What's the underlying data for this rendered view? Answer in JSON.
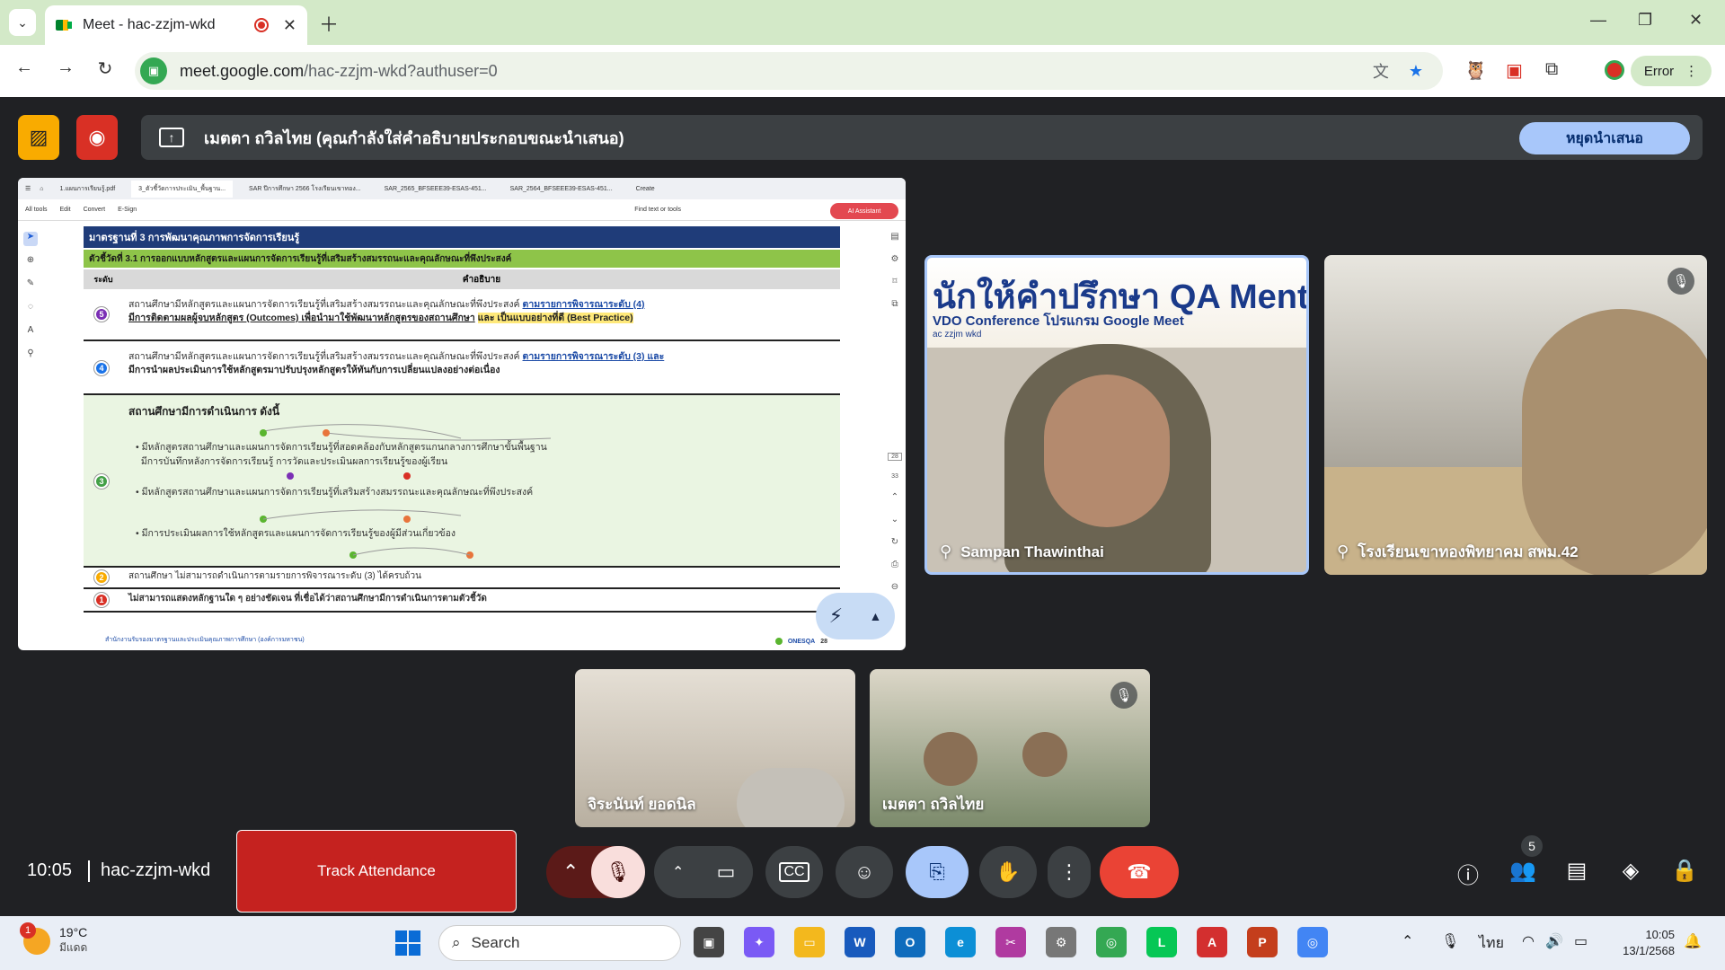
{
  "browser": {
    "tab_title": "Meet - hac-zzjm-wkd",
    "url_host": "meet.google.com",
    "url_path": "/hac-zzjm-wkd?authuser=0",
    "profile_label": "Error"
  },
  "meet": {
    "presenting_banner": "เมตตา ถวิลไทย (คุณกำลังใส่คำอธิบายประกอบขณะนำเสนอ)",
    "stop_presenting": "หยุดนำเสนอ",
    "time": "10:05",
    "meeting_code": "hac-zzjm-wkd",
    "track_attendance": "Track Attendance",
    "participant_count": "5",
    "participants": [
      {
        "name": "Sampan Thawinthai"
      },
      {
        "name": "โรงเรียนเขาทองพิทยาคม สพม.42"
      },
      {
        "name": "จิระนันท์ ยอดนิล"
      },
      {
        "name": "เมตตา ถวิลไทย"
      }
    ],
    "qa_banner": {
      "title": "นักให้คำปรึกษา QA Mentor",
      "sub": "VDO Conference โปรแกรม Google Meet",
      "code": "ac zzjm wkd"
    }
  },
  "shared_doc": {
    "tabs": [
      "1.แผนการเรียนรู้.pdf",
      "3_ตัวชี้วัดการประเมิน_พื้นฐาน...",
      "SAR ปีการศึกษา 2566 โรงเรียนเขาทอง...",
      "SAR_2565_BFSEEE39-ESAS-451...",
      "SAR_2564_BFSEEE39-ESAS-451...",
      "Create"
    ],
    "tools": [
      "All tools",
      "Edit",
      "Convert",
      "E-Sign"
    ],
    "find_label": "Find text or tools",
    "ai_label": "AI Assistant",
    "standard_title": "มาตรฐานที่ 3 การพัฒนาคุณภาพการจัดการเรียนรู้",
    "indicator": "ตัวชี้วัดที่ 3.1 การออกแบบหลักสูตรและแผนการจัดการเรียนรู้ที่เสริมสร้างสมรรถนะและคุณลักษณะที่พึงประสงค์",
    "col_level": "ระดับ",
    "col_desc": "คำอธิบาย",
    "level5_a": "สถานศึกษามีหลักสูตรและแผนการจัดการเรียนรู้ที่เสริมสร้างสมรรถนะและคุณลักษณะที่พึงประสงค์",
    "level5_b": "ตามรายการพิจารณาระดับ (4)",
    "level5_c": "มีการติดตามผลผู้จบหลักสูตร (Outcomes) เพื่อนำมาใช้พัฒนาหลักสูตรของสถานศึกษา",
    "level5_d": "และ เป็นแบบอย่างที่ดี (Best Practice)",
    "level4_a": "สถานศึกษามีหลักสูตรและแผนการจัดการเรียนรู้ที่เสริมสร้างสมรรถนะและคุณลักษณะที่พึงประสงค์",
    "level4_b": "ตามรายการพิจารณาระดับ (3) และ",
    "level4_c": "มีการนำผลประเมินการใช้หลักสูตรมาปรับปรุงหลักสูตรให้ทันกับการเปลี่ยนแปลงอย่างต่อเนื่อง",
    "level3_head": "สถานศึกษามีการดำเนินการ ดังนี้",
    "level3_b1": "มีหลักสูตรสถานศึกษาและแผนการจัดการเรียนรู้ที่สอดคล้องกับหลักสูตรแกนกลางการศึกษาขั้นพื้นฐาน",
    "level3_b1b": "มีการบันทึกหลังการจัดการเรียนรู้ การวัดและประเมินผลการเรียนรู้ของผู้เรียน",
    "level3_b2": "มีหลักสูตรสถานศึกษาและแผนการจัดการเรียนรู้ที่เสริมสร้างสมรรถนะและคุณลักษณะที่พึงประสงค์",
    "level3_b3": "มีการประเมินผลการใช้หลักสูตรและแผนการจัดการเรียนรู้ของผู้มีส่วนเกี่ยวข้อง",
    "level2": "สถานศึกษา ไม่สามารถดำเนินการตามรายการพิจารณาระดับ (3) ได้ครบถ้วน",
    "level1": "ไม่สามารถแสดงหลักฐานใด ๆ อย่างชัดเจน ที่เชื่อได้ว่าสถานศึกษามีการดำเนินการตามตัวชี้วัด",
    "footer": "สำนักงานรับรองมาตรฐานและประเมินคุณภาพการศึกษา (องค์การมหาชน)",
    "page_no": "28",
    "brand": "ONESQA",
    "zoom_page": "28",
    "zoom_total": "33"
  },
  "taskbar": {
    "temp": "19°C",
    "weather_desc": "มีแดด",
    "notif_count": "1",
    "search_label": "Search",
    "lang": "ไทย",
    "clock_time": "10:05",
    "clock_date": "13/1/2568"
  },
  "colors": {
    "meet_bg": "#202124",
    "end_call": "#ea4335",
    "accent_blue": "#a8c7fa",
    "track_red": "#c5221f",
    "tab_green": "#d3e9c8"
  }
}
